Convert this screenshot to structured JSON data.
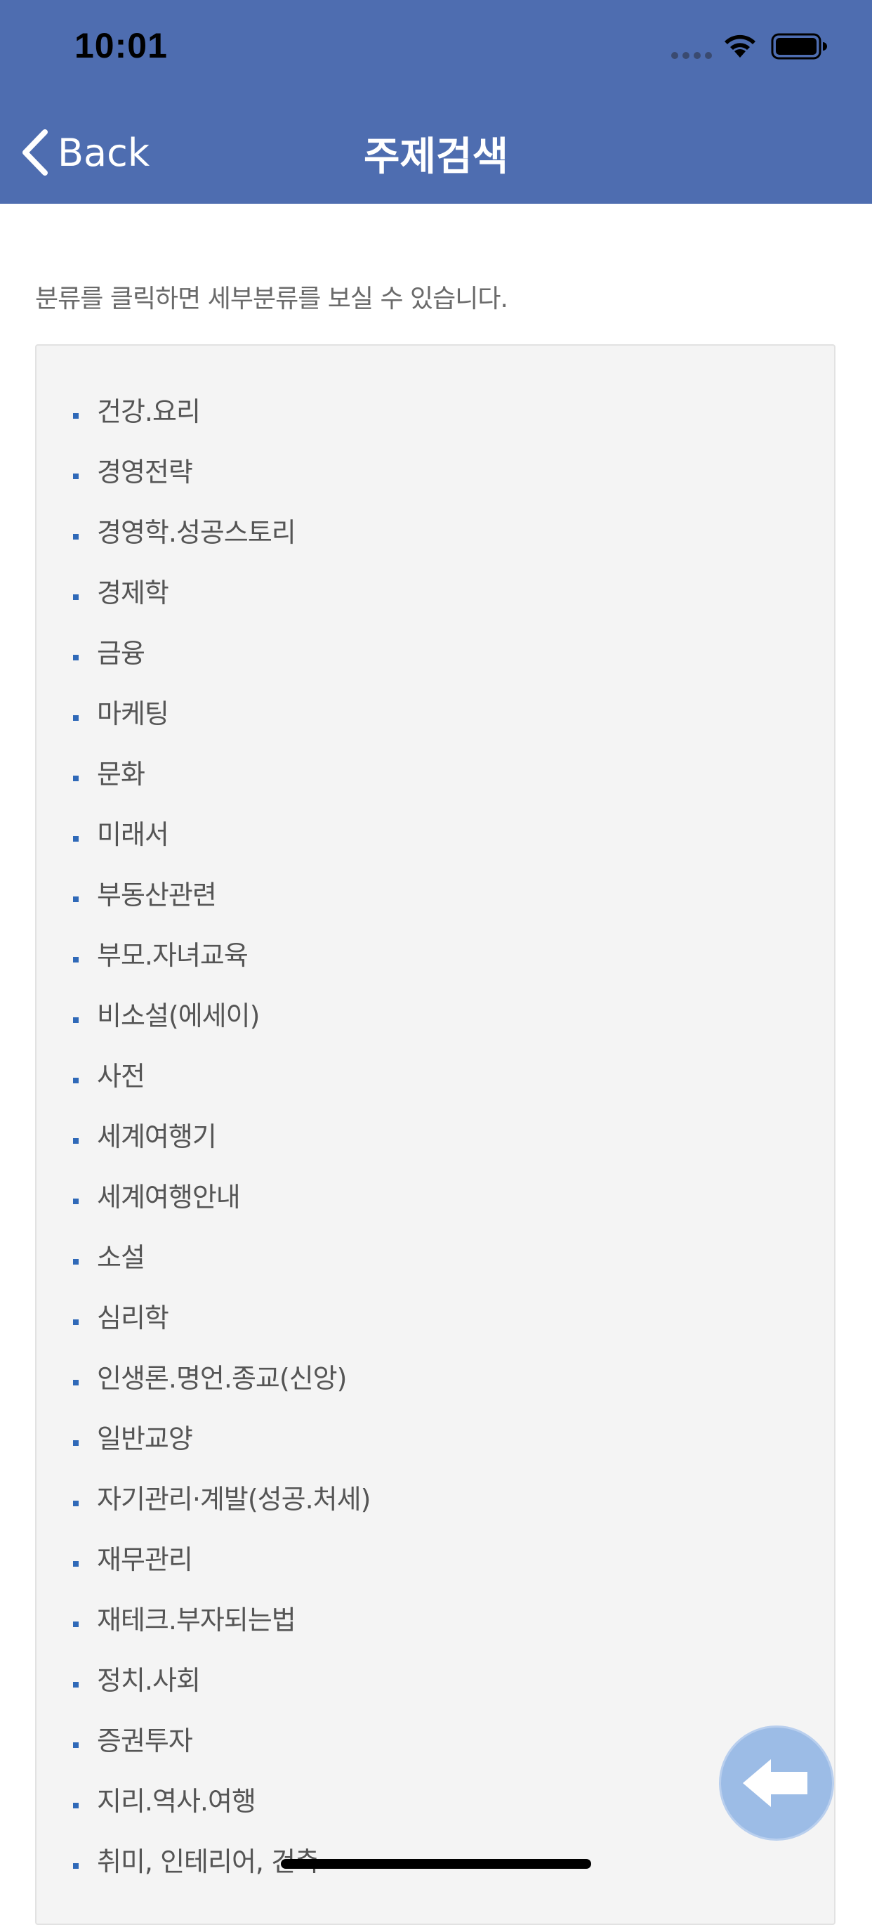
{
  "status_bar": {
    "time": "10:01"
  },
  "nav": {
    "back_label": "Back",
    "title": "주제검색"
  },
  "instruction": "분류를 클릭하면 세부분류를 보실 수 있습니다.",
  "categories": [
    "건강.요리",
    "경영전략",
    "경영학.성공스토리",
    "경제학",
    "금융",
    "마케팅",
    "문화",
    "미래서",
    "부동산관련",
    "부모.자녀교육",
    "비소설(에세이)",
    "사전",
    "세계여행기",
    "세계여행안내",
    "소설",
    "심리학",
    "인생론.명언.종교(신앙)",
    "일반교양",
    "자기관리·계발(성공.처세)",
    "재무관리",
    "재테크.부자되는법",
    "정치.사회",
    "증권투자",
    "지리.역사.여행",
    "취미, 인테리어, 건축"
  ],
  "colors": {
    "nav_background": "#4e6db0",
    "bullet": "#2f69b8",
    "panel_background": "#f4f4f4",
    "fab_background": "#9cbce6"
  },
  "icons": {
    "back": "chevron-left-icon",
    "fab": "arrow-left-icon"
  }
}
